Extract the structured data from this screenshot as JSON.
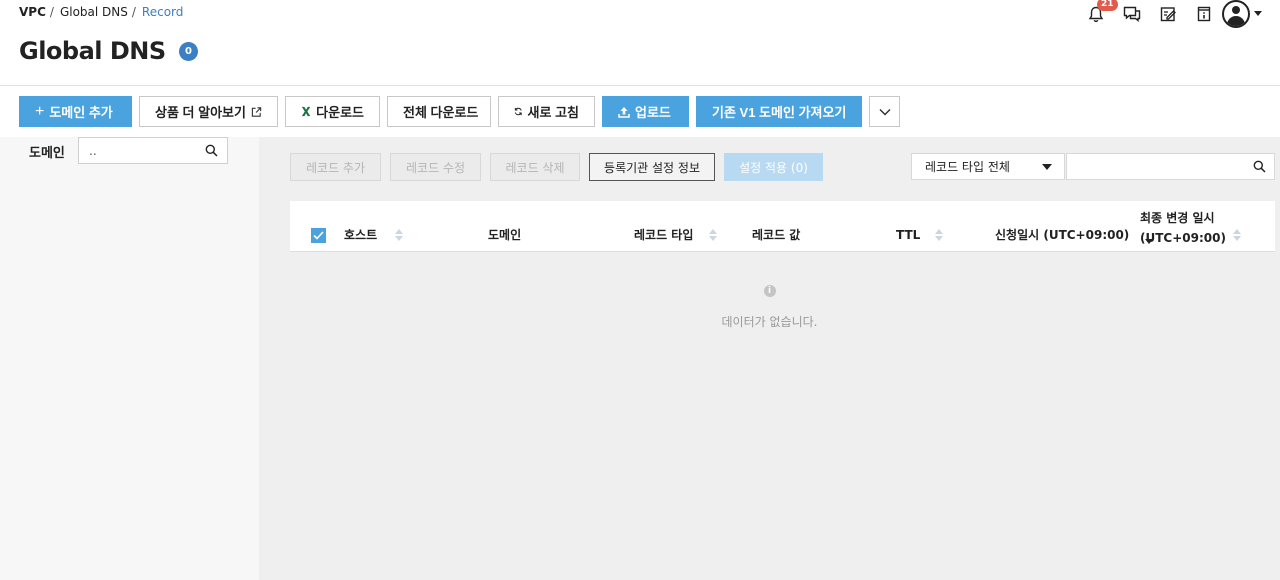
{
  "breadcrumb": {
    "root": "VPC",
    "service": "Global DNS",
    "current": "Record"
  },
  "page": {
    "title": "Global DNS",
    "count": "0"
  },
  "header_icons": {
    "notification_count": "21"
  },
  "toolbar": {
    "add_domain": "도메인 추가",
    "learn_more": "상품 더 알아보기",
    "download": "다운로드",
    "download_all": "전체 다운로드",
    "refresh": "새로 고침",
    "upload": "업로드",
    "import_v1": "기존 V1 도메인 가져오기"
  },
  "sidebar": {
    "label": "도메인",
    "search_value": ".."
  },
  "record_toolbar": {
    "add": "레코드 추가",
    "edit": "레코드 수정",
    "delete": "레코드 삭제",
    "registrar": "등록기관 설정 정보",
    "apply": "설정 적용 (0)"
  },
  "filter": {
    "type_selected": "레코드 타입 전체",
    "search_value": ""
  },
  "table": {
    "columns": [
      "호스트",
      "도메인",
      "레코드 타입",
      "레코드 값",
      "TTL",
      "신청일시 (UTC+09:00)",
      "최종 변경 일시",
      "(UTC+09:00)"
    ],
    "empty_message": "데이터가 없습니다."
  },
  "colors": {
    "accent": "#4aa3df",
    "link": "#3b7fc4",
    "badge": "#e05a4e",
    "excel": "#1e7145"
  }
}
